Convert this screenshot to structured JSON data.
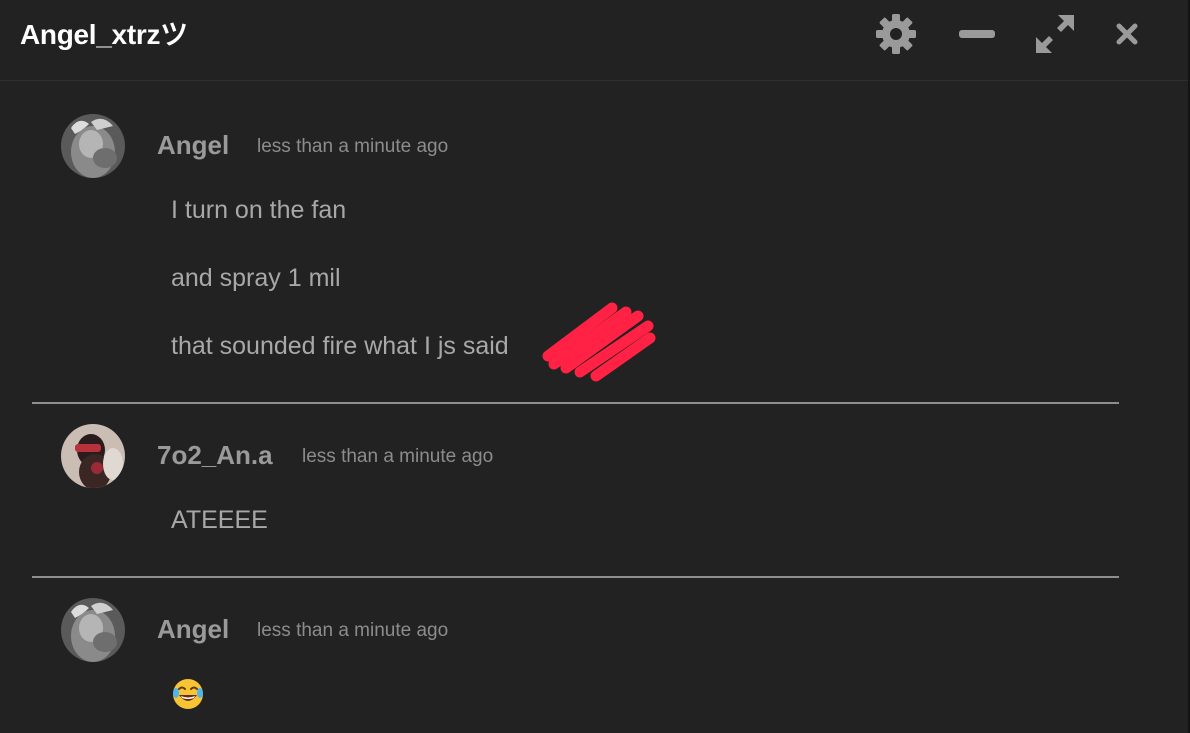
{
  "window": {
    "title": "Angel_xtrzツ",
    "controls": {
      "settings_icon": "gear-icon",
      "minimize_icon": "minimize-icon",
      "maximize_icon": "expand-icon",
      "close_icon": "close-icon"
    }
  },
  "messages": [
    {
      "author": "Angel",
      "time": "less than a minute ago",
      "lines": [
        "I turn on the fan",
        "and spray 1 mil",
        "that sounded fire what I js said"
      ]
    },
    {
      "author": "7o2_An.a",
      "time": "less than a minute ago",
      "lines": [
        "ATEEEE"
      ]
    },
    {
      "author": "Angel",
      "time": "less than a minute ago",
      "lines": [],
      "emoji": "face-with-tears-of-joy"
    }
  ],
  "colors": {
    "background": "#222222",
    "title": "#ffffff",
    "author": "#9a9a9a",
    "timestamp": "#8c8c8c",
    "message_text": "#a8a8a8",
    "divider": "#8e8e8e",
    "icon": "#9a9a9a",
    "scribble": "#ff2244"
  }
}
